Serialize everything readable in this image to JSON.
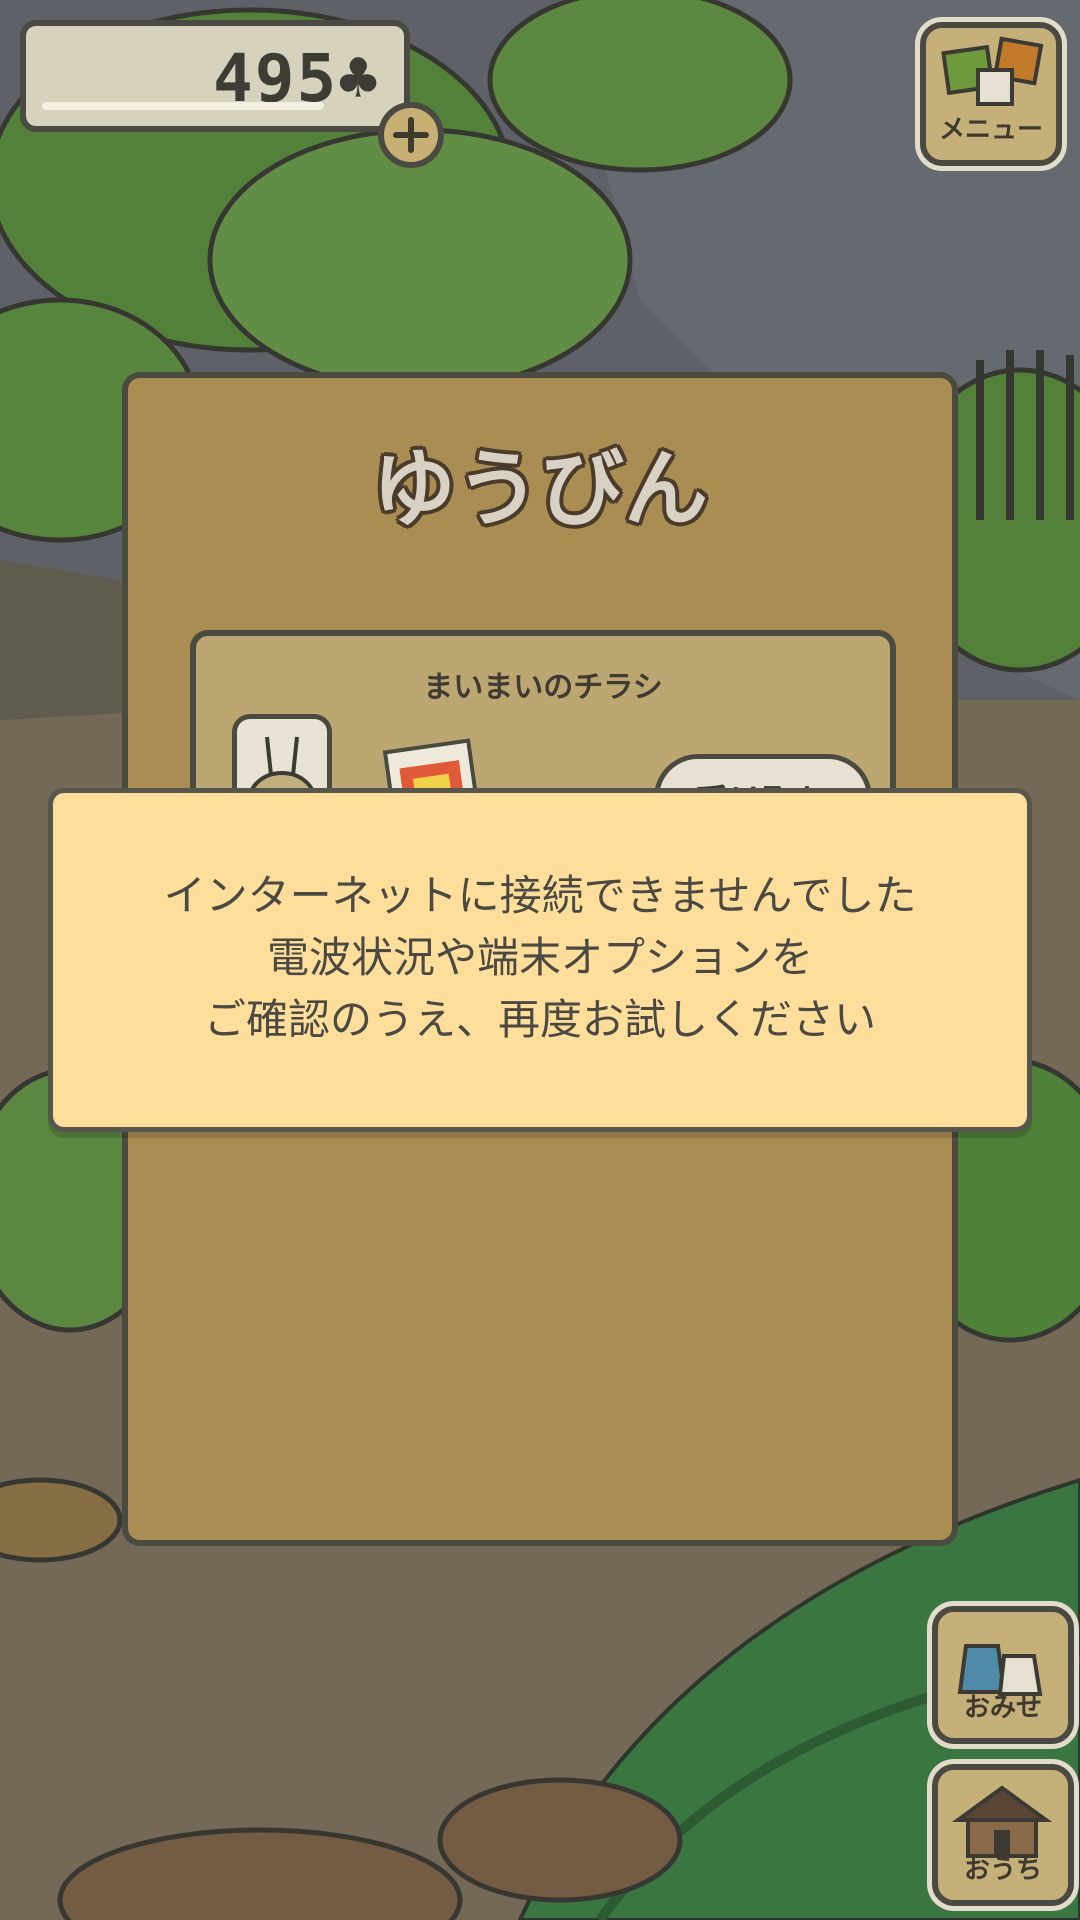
{
  "currency": {
    "amount": "495"
  },
  "menu_button": {
    "label": "メニュー"
  },
  "mail": {
    "title": "ゆうびん",
    "item": {
      "title": "まいまいのチラシ",
      "receive_label": "受け取り"
    }
  },
  "error_dialog": {
    "lines": [
      "インターネットに接続できませんでした",
      "電波状況や端末オプションを",
      "ご確認のうえ、再度お試しください"
    ]
  },
  "shop_button": {
    "label": "おみせ"
  },
  "home_button": {
    "label": "おうち"
  },
  "colors": {
    "panel": "#a98d52",
    "dialog": "#ffde9c",
    "outline": "#4b4a3f"
  }
}
